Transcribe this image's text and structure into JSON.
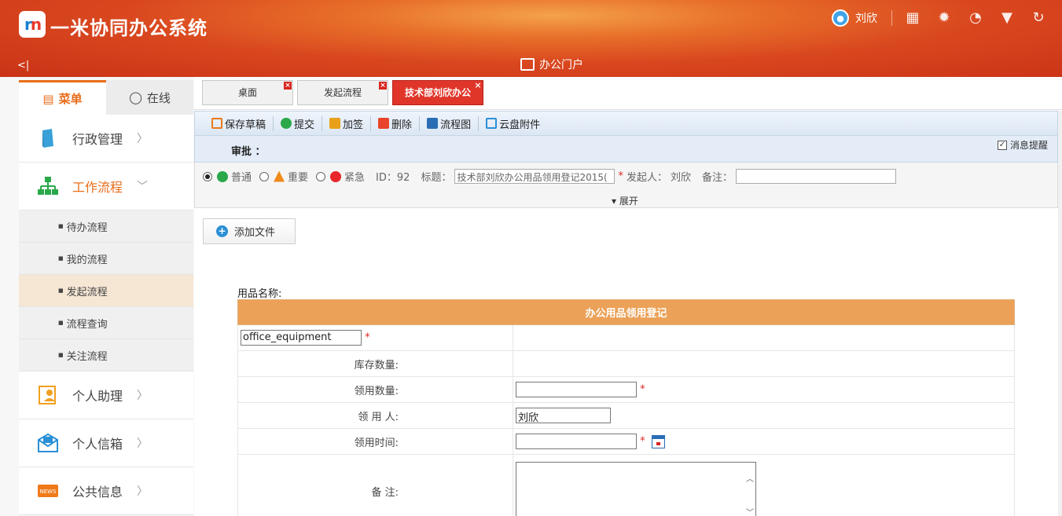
{
  "header": {
    "app_title": "一米协同办公系统",
    "user_name": "刘欣",
    "portal": "办公门户",
    "collapse": "<|",
    "icons": [
      "calendar-icon",
      "gear-icon",
      "message-icon",
      "shirt-icon",
      "refresh-icon"
    ]
  },
  "sidebar": {
    "tabs": [
      {
        "label": "菜单"
      },
      {
        "label": "在线"
      }
    ],
    "items": [
      {
        "label": "行政管理"
      },
      {
        "label": "工作流程"
      },
      {
        "label": "个人助理"
      },
      {
        "label": "个人信箱"
      },
      {
        "label": "公共信息"
      }
    ],
    "sub_items": [
      {
        "label": "待办流程"
      },
      {
        "label": "我的流程"
      },
      {
        "label": "发起流程"
      },
      {
        "label": "流程查询"
      },
      {
        "label": "关注流程"
      }
    ],
    "news_badge": "NEWS"
  },
  "page_tabs": [
    {
      "label": "桌面"
    },
    {
      "label": "发起流程"
    },
    {
      "label": "技术部刘欣办公"
    }
  ],
  "toolbar": {
    "save_draft": "保存草稿",
    "submit": "提交",
    "add_sign": "加签",
    "delete": "删除",
    "flowchart": "流程图",
    "cloud": "云盘附件"
  },
  "approval": {
    "label": "审批 ：",
    "notify": "消息提醒"
  },
  "meta": {
    "normal": "普通",
    "important": "重要",
    "urgent": "紧急",
    "id_text": "ID：92",
    "title_label": "标题：",
    "title_value": "技术部刘欣办公用品领用登记2015(",
    "initiator_label": "发起人：",
    "initiator": "刘欣",
    "remark_label": "备注：",
    "expand": "展开"
  },
  "content": {
    "add_file": "添加文件",
    "goods_label": "用品名称:",
    "form_title": "办公用品领用登记",
    "goods_value": "office_equipment",
    "stock_label": "库存数量:",
    "qty_label": "领用数量:",
    "person_label": "领  用  人:",
    "person_value": "刘欣",
    "time_label": "领用时间:",
    "remark_label": "备       注:"
  },
  "colors": {
    "accent": "#e86d1a",
    "header": "#d9471f",
    "form_header": "#eba157"
  }
}
